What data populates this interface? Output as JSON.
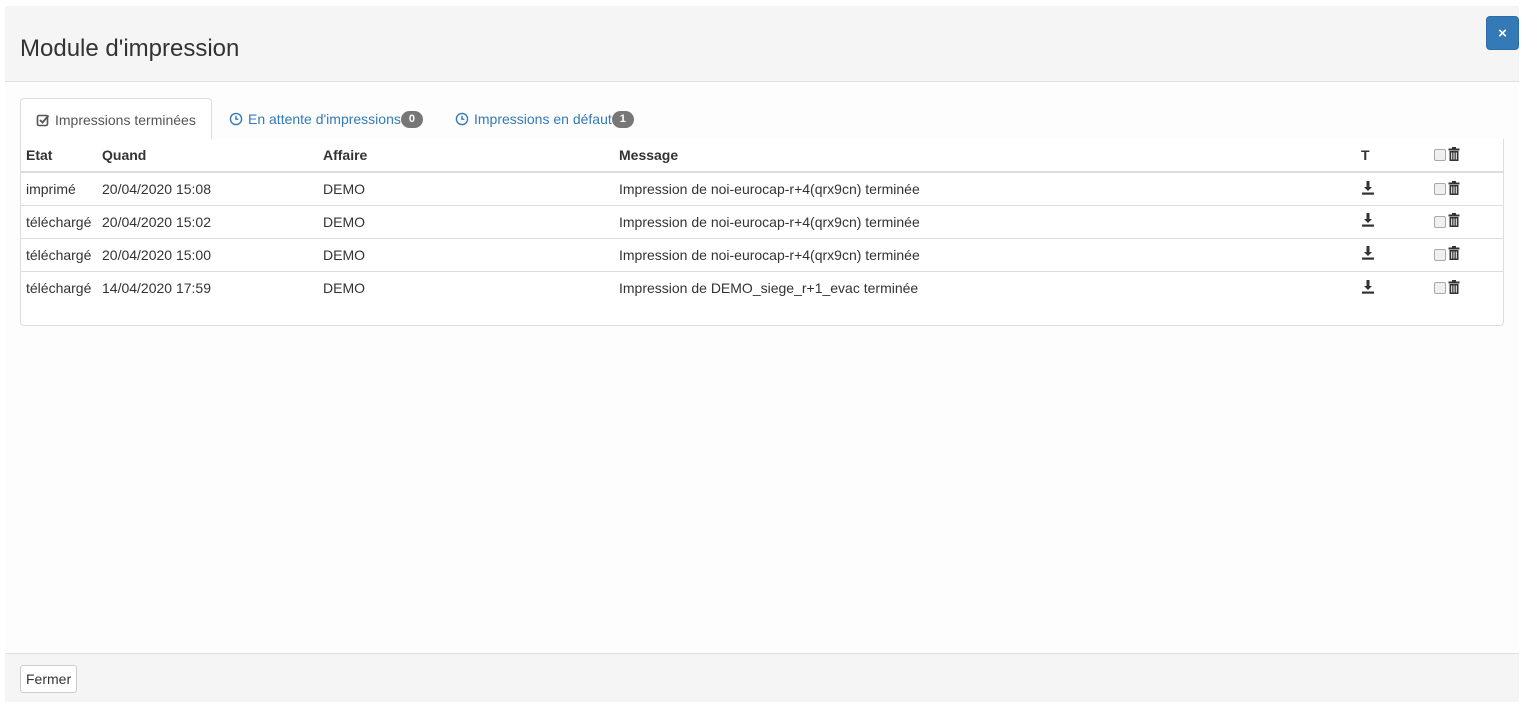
{
  "modal": {
    "title": "Module d'impression",
    "close_label": "×"
  },
  "tabs": [
    {
      "label": "Impressions terminées",
      "icon": "check-square-icon",
      "badge": null,
      "active": true
    },
    {
      "label": "En attente d'impressions",
      "icon": "clock-icon",
      "badge": "0",
      "active": false
    },
    {
      "label": "Impressions en défaut",
      "icon": "clock-icon",
      "badge": "1",
      "active": false
    }
  ],
  "table": {
    "headers": {
      "etat": "Etat",
      "quand": "Quand",
      "affaire": "Affaire",
      "message": "Message",
      "t": "T"
    },
    "rows": [
      {
        "etat": "imprimé",
        "quand": "20/04/2020 15:08",
        "affaire": "DEMO",
        "message": "Impression de noi-eurocap-r+4(qrx9cn) terminée"
      },
      {
        "etat": "téléchargé",
        "quand": "20/04/2020 15:02",
        "affaire": "DEMO",
        "message": "Impression de noi-eurocap-r+4(qrx9cn) terminée"
      },
      {
        "etat": "téléchargé",
        "quand": "20/04/2020 15:00",
        "affaire": "DEMO",
        "message": "Impression de noi-eurocap-r+4(qrx9cn) terminée"
      },
      {
        "etat": "téléchargé",
        "quand": "14/04/2020 17:59",
        "affaire": "DEMO",
        "message": "Impression de DEMO_siege_r+1_evac terminée"
      }
    ]
  },
  "footer": {
    "close_button": "Fermer"
  },
  "colors": {
    "primary": "#337ab7",
    "badge": "#777777",
    "header_bg": "#f5f5f5"
  }
}
